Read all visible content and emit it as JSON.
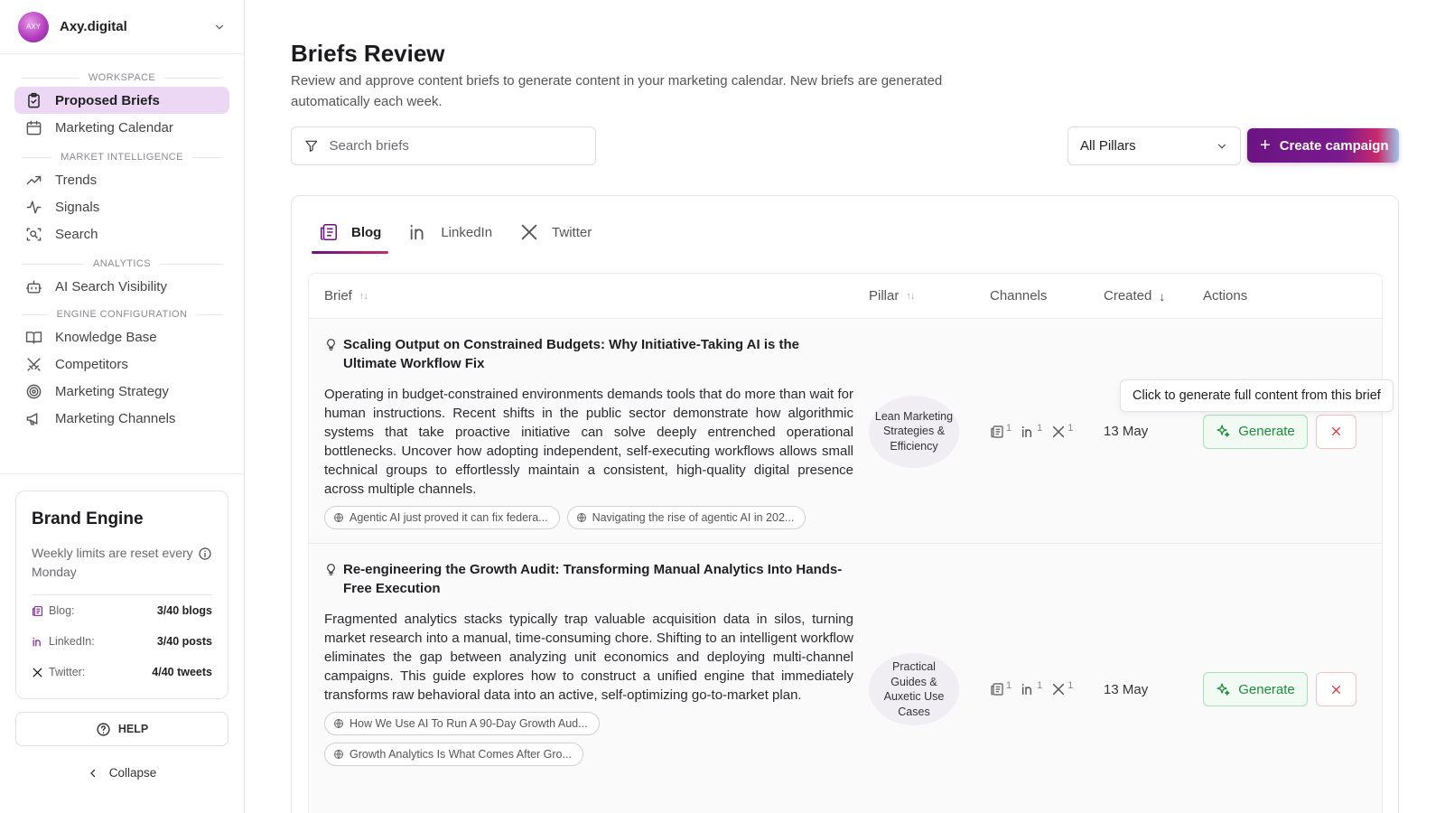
{
  "workspace": {
    "logo_text": "AXY",
    "name": "Axy.digital"
  },
  "sidebar": {
    "sections": {
      "workspace": "WORKSPACE",
      "market_intelligence": "MARKET INTELLIGENCE",
      "analytics": "ANALYTICS",
      "engine_configuration": "ENGINE CONFIGURATION"
    },
    "items": {
      "proposed_briefs": "Proposed Briefs",
      "marketing_calendar": "Marketing Calendar",
      "trends": "Trends",
      "signals": "Signals",
      "search": "Search",
      "ai_search_visibility": "AI Search Visibility",
      "knowledge_base": "Knowledge Base",
      "competitors": "Competitors",
      "marketing_strategy": "Marketing Strategy",
      "marketing_channels": "Marketing Channels"
    },
    "active_item": "proposed_briefs"
  },
  "brand_engine": {
    "title": "Brand Engine",
    "subtitle": "Weekly limits are reset every Monday",
    "limits": [
      {
        "label": "Blog:",
        "value": "3/40 blogs"
      },
      {
        "label": "LinkedIn:",
        "value": "3/40 posts"
      },
      {
        "label": "Twitter:",
        "value": "4/40 tweets"
      }
    ],
    "help_label": "HELP",
    "collapse_label": "Collapse"
  },
  "page": {
    "title": "Briefs Review",
    "description": "Review and approve content briefs to generate content in your marketing calendar. New briefs are generated automatically each week.",
    "search_placeholder": "Search briefs",
    "pillar_filter": "All Pillars",
    "create_button": "Create campaign"
  },
  "tabs": [
    {
      "label": "Blog",
      "icon": "newspaper-icon",
      "active": true
    },
    {
      "label": "LinkedIn",
      "icon": "linkedin-icon",
      "active": false
    },
    {
      "label": "Twitter",
      "icon": "x-icon",
      "active": false
    }
  ],
  "table": {
    "columns": {
      "brief": "Brief",
      "pillar": "Pillar",
      "channels": "Channels",
      "created": "Created",
      "actions": "Actions"
    },
    "rows": [
      {
        "title": "Scaling Output on Constrained Budgets: Why Initiative-Taking AI is the Ultimate Workflow Fix",
        "body": "Operating in budget-constrained environments demands tools that do more than wait for human instructions. Recent shifts in the public sector demonstrate how algorithmic systems that take proactive initiative can solve deeply entrenched operational bottlenecks. Uncover how adopting independent, self-executing workflows allows small technical groups to effortlessly maintain a consistent, high-quality digital presence across multiple channels.",
        "sources": [
          "Agentic AI just proved it can fix federa...",
          "Navigating the rise of agentic AI in 202..."
        ],
        "pillar": "Lean Marketing Strategies & Efficiency",
        "channels": {
          "blog": "1",
          "linkedin": "1",
          "twitter": "1"
        },
        "created": "13 May",
        "generate_label": "Generate"
      },
      {
        "title": "Re-engineering the Growth Audit: Transforming Manual Analytics Into Hands-Free Execution",
        "body": "Fragmented analytics stacks typically trap valuable acquisition data in silos, turning market research into a manual, time-consuming chore. Shifting to an intelligent workflow eliminates the gap between analyzing unit economics and deploying multi-channel campaigns. This guide explores how to construct a unified engine that immediately transforms raw behavioral data into an active, self-optimizing go-to-market plan.",
        "sources": [
          "How We Use AI To Run A 90-Day Growth Aud...",
          "Growth Analytics Is What Comes After Gro..."
        ],
        "pillar": "Practical Guides & Auxetic Use Cases",
        "channels": {
          "blog": "1",
          "linkedin": "1",
          "twitter": "1"
        },
        "created": "13 May",
        "generate_label": "Generate"
      }
    ]
  },
  "tooltip": "Click to generate full content from this brief",
  "colors": {
    "accent": "#6b1482",
    "active_nav_bg": "#ecd7f5",
    "generate_green": "#1f8a3c",
    "reject_red": "#d93636"
  }
}
